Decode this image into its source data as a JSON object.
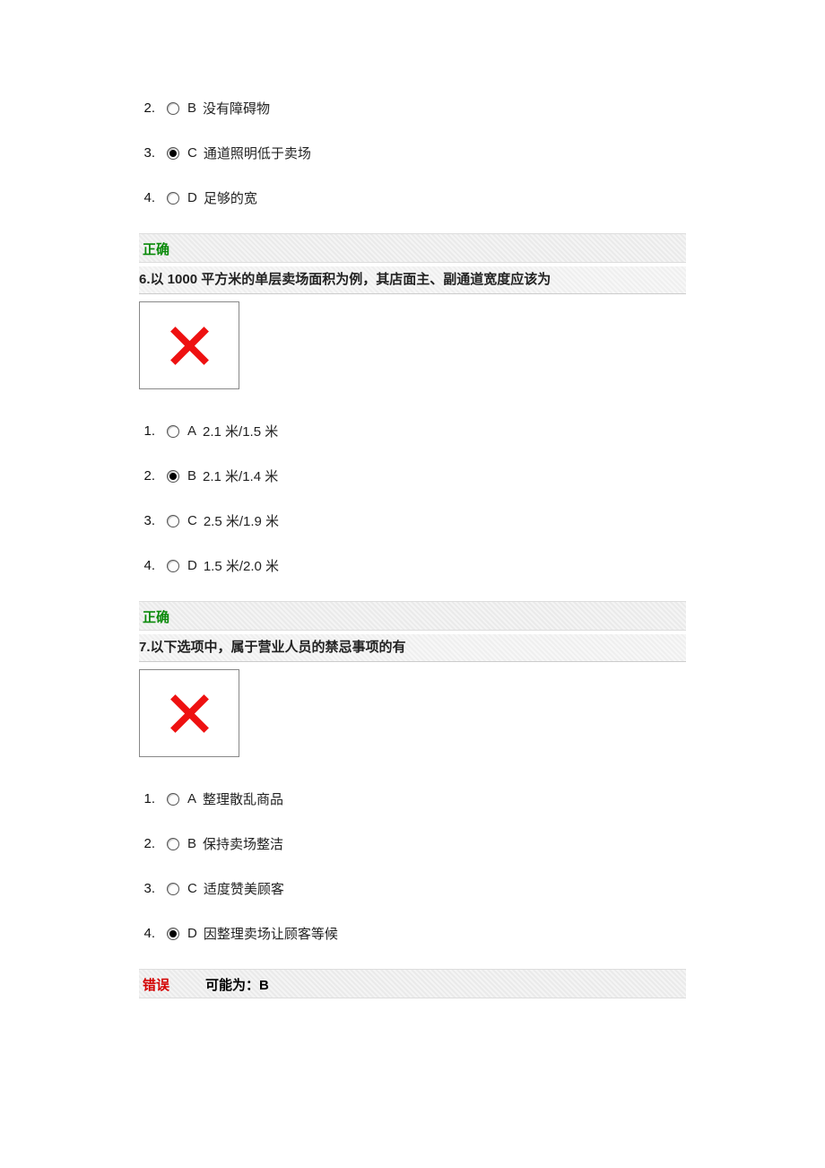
{
  "q5": {
    "options": [
      {
        "num": "2.",
        "letter": "B",
        "text": "没有障碍物",
        "selected": false
      },
      {
        "num": "3.",
        "letter": "C",
        "text": "通道照明低于卖场",
        "selected": true
      },
      {
        "num": "4.",
        "letter": "D",
        "text": "足够的宽",
        "selected": false
      }
    ]
  },
  "status": {
    "correct": "正确",
    "wrong": "错误",
    "hint_label": "可能为：",
    "hint_value": "B"
  },
  "q6": {
    "num": "6.",
    "title": "以 1000 平方米的单层卖场面积为例，其店面主、副通道宽度应该为",
    "options": [
      {
        "num": "1.",
        "letter": "A",
        "text": "2.1 米/1.5 米",
        "selected": false
      },
      {
        "num": "2.",
        "letter": "B",
        "text": "2.1 米/1.4 米",
        "selected": true
      },
      {
        "num": "3.",
        "letter": "C",
        "text": "2.5 米/1.9 米",
        "selected": false
      },
      {
        "num": "4.",
        "letter": "D",
        "text": "1.5 米/2.0 米",
        "selected": false
      }
    ]
  },
  "q7": {
    "num": "7.",
    "title": "以下选项中，属于营业人员的禁忌事项的有",
    "options": [
      {
        "num": "1.",
        "letter": "A",
        "text": "整理散乱商品",
        "selected": false
      },
      {
        "num": "2.",
        "letter": "B",
        "text": "保持卖场整洁",
        "selected": false
      },
      {
        "num": "3.",
        "letter": "C",
        "text": "适度赞美顾客",
        "selected": false
      },
      {
        "num": "4.",
        "letter": "D",
        "text": "因整理卖场让顾客等候",
        "selected": true
      }
    ]
  }
}
